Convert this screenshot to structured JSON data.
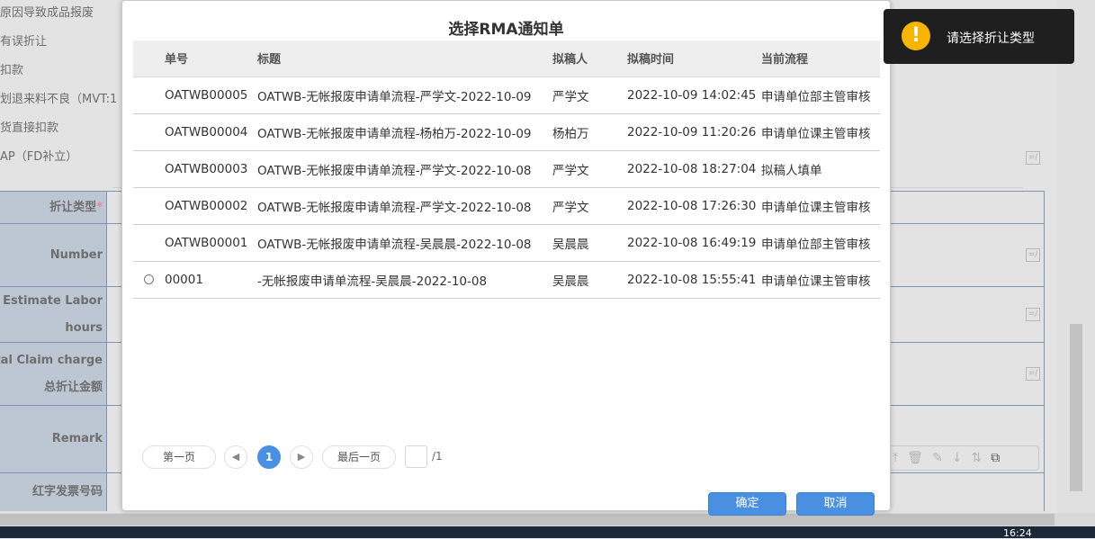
{
  "background": {
    "options": [
      "原因导致成品报废",
      "有误折让",
      "扣款",
      "划退来料不良（MVT:1",
      "货直接扣款",
      "AP（FD补立）"
    ],
    "labels": {
      "discount_type": "折让类型",
      "required": "*",
      "number": "Number",
      "labor_1": "Estimate Labor",
      "labor_2": "hours",
      "claim_1": "tal Claim charge",
      "claim_2": "总折让金额",
      "remark": "Remark",
      "red_invoice": "红字发票号码"
    }
  },
  "modal": {
    "title": "选择RMA通知单",
    "columns": [
      "单号",
      "标题",
      "拟稿人",
      "拟稿时间",
      "当前流程"
    ],
    "rows": [
      {
        "id": "OATWB00005",
        "title": "OATWB-无帐报废申请单流程-严学文-2022-10-09",
        "author": "严学文",
        "time": "2022-10-09 14:02:45",
        "flow": "申请单位部主管审核",
        "radio": false
      },
      {
        "id": "OATWB00004",
        "title": "OATWB-无帐报废申请单流程-杨柏万-2022-10-09",
        "author": "杨柏万",
        "time": "2022-10-09 11:20:26",
        "flow": "申请单位课主管审核",
        "radio": false
      },
      {
        "id": "OATWB00003",
        "title": "OATWB-无帐报废申请单流程-严学文-2022-10-08",
        "author": "严学文",
        "time": "2022-10-08 18:27:04",
        "flow": "拟稿人填单",
        "radio": false
      },
      {
        "id": "OATWB00002",
        "title": "OATWB-无帐报废申请单流程-严学文-2022-10-08",
        "author": "严学文",
        "time": "2022-10-08 17:26:30",
        "flow": "申请单位课主管审核",
        "radio": false
      },
      {
        "id": "OATWB00001",
        "title": "OATWB-无帐报废申请单流程-吴晨晨-2022-10-08",
        "author": "吴晨晨",
        "time": "2022-10-08 16:49:19",
        "flow": "申请单位部主管审核",
        "radio": false
      },
      {
        "id": "00001",
        "title": "-无帐报废申请单流程-吴晨晨-2022-10-08",
        "author": "吴晨晨",
        "time": "2022-10-08 15:55:41",
        "flow": "申请单位课主管审核",
        "radio": true
      }
    ],
    "pager": {
      "first": "第一页",
      "last": "最后一页",
      "current": "1",
      "total": "/1"
    },
    "confirm": "确定",
    "cancel": "取消"
  },
  "toast": {
    "icon": "warning-icon",
    "message": "请选择折让类型"
  },
  "taskbar": {
    "clock": "16:24"
  }
}
